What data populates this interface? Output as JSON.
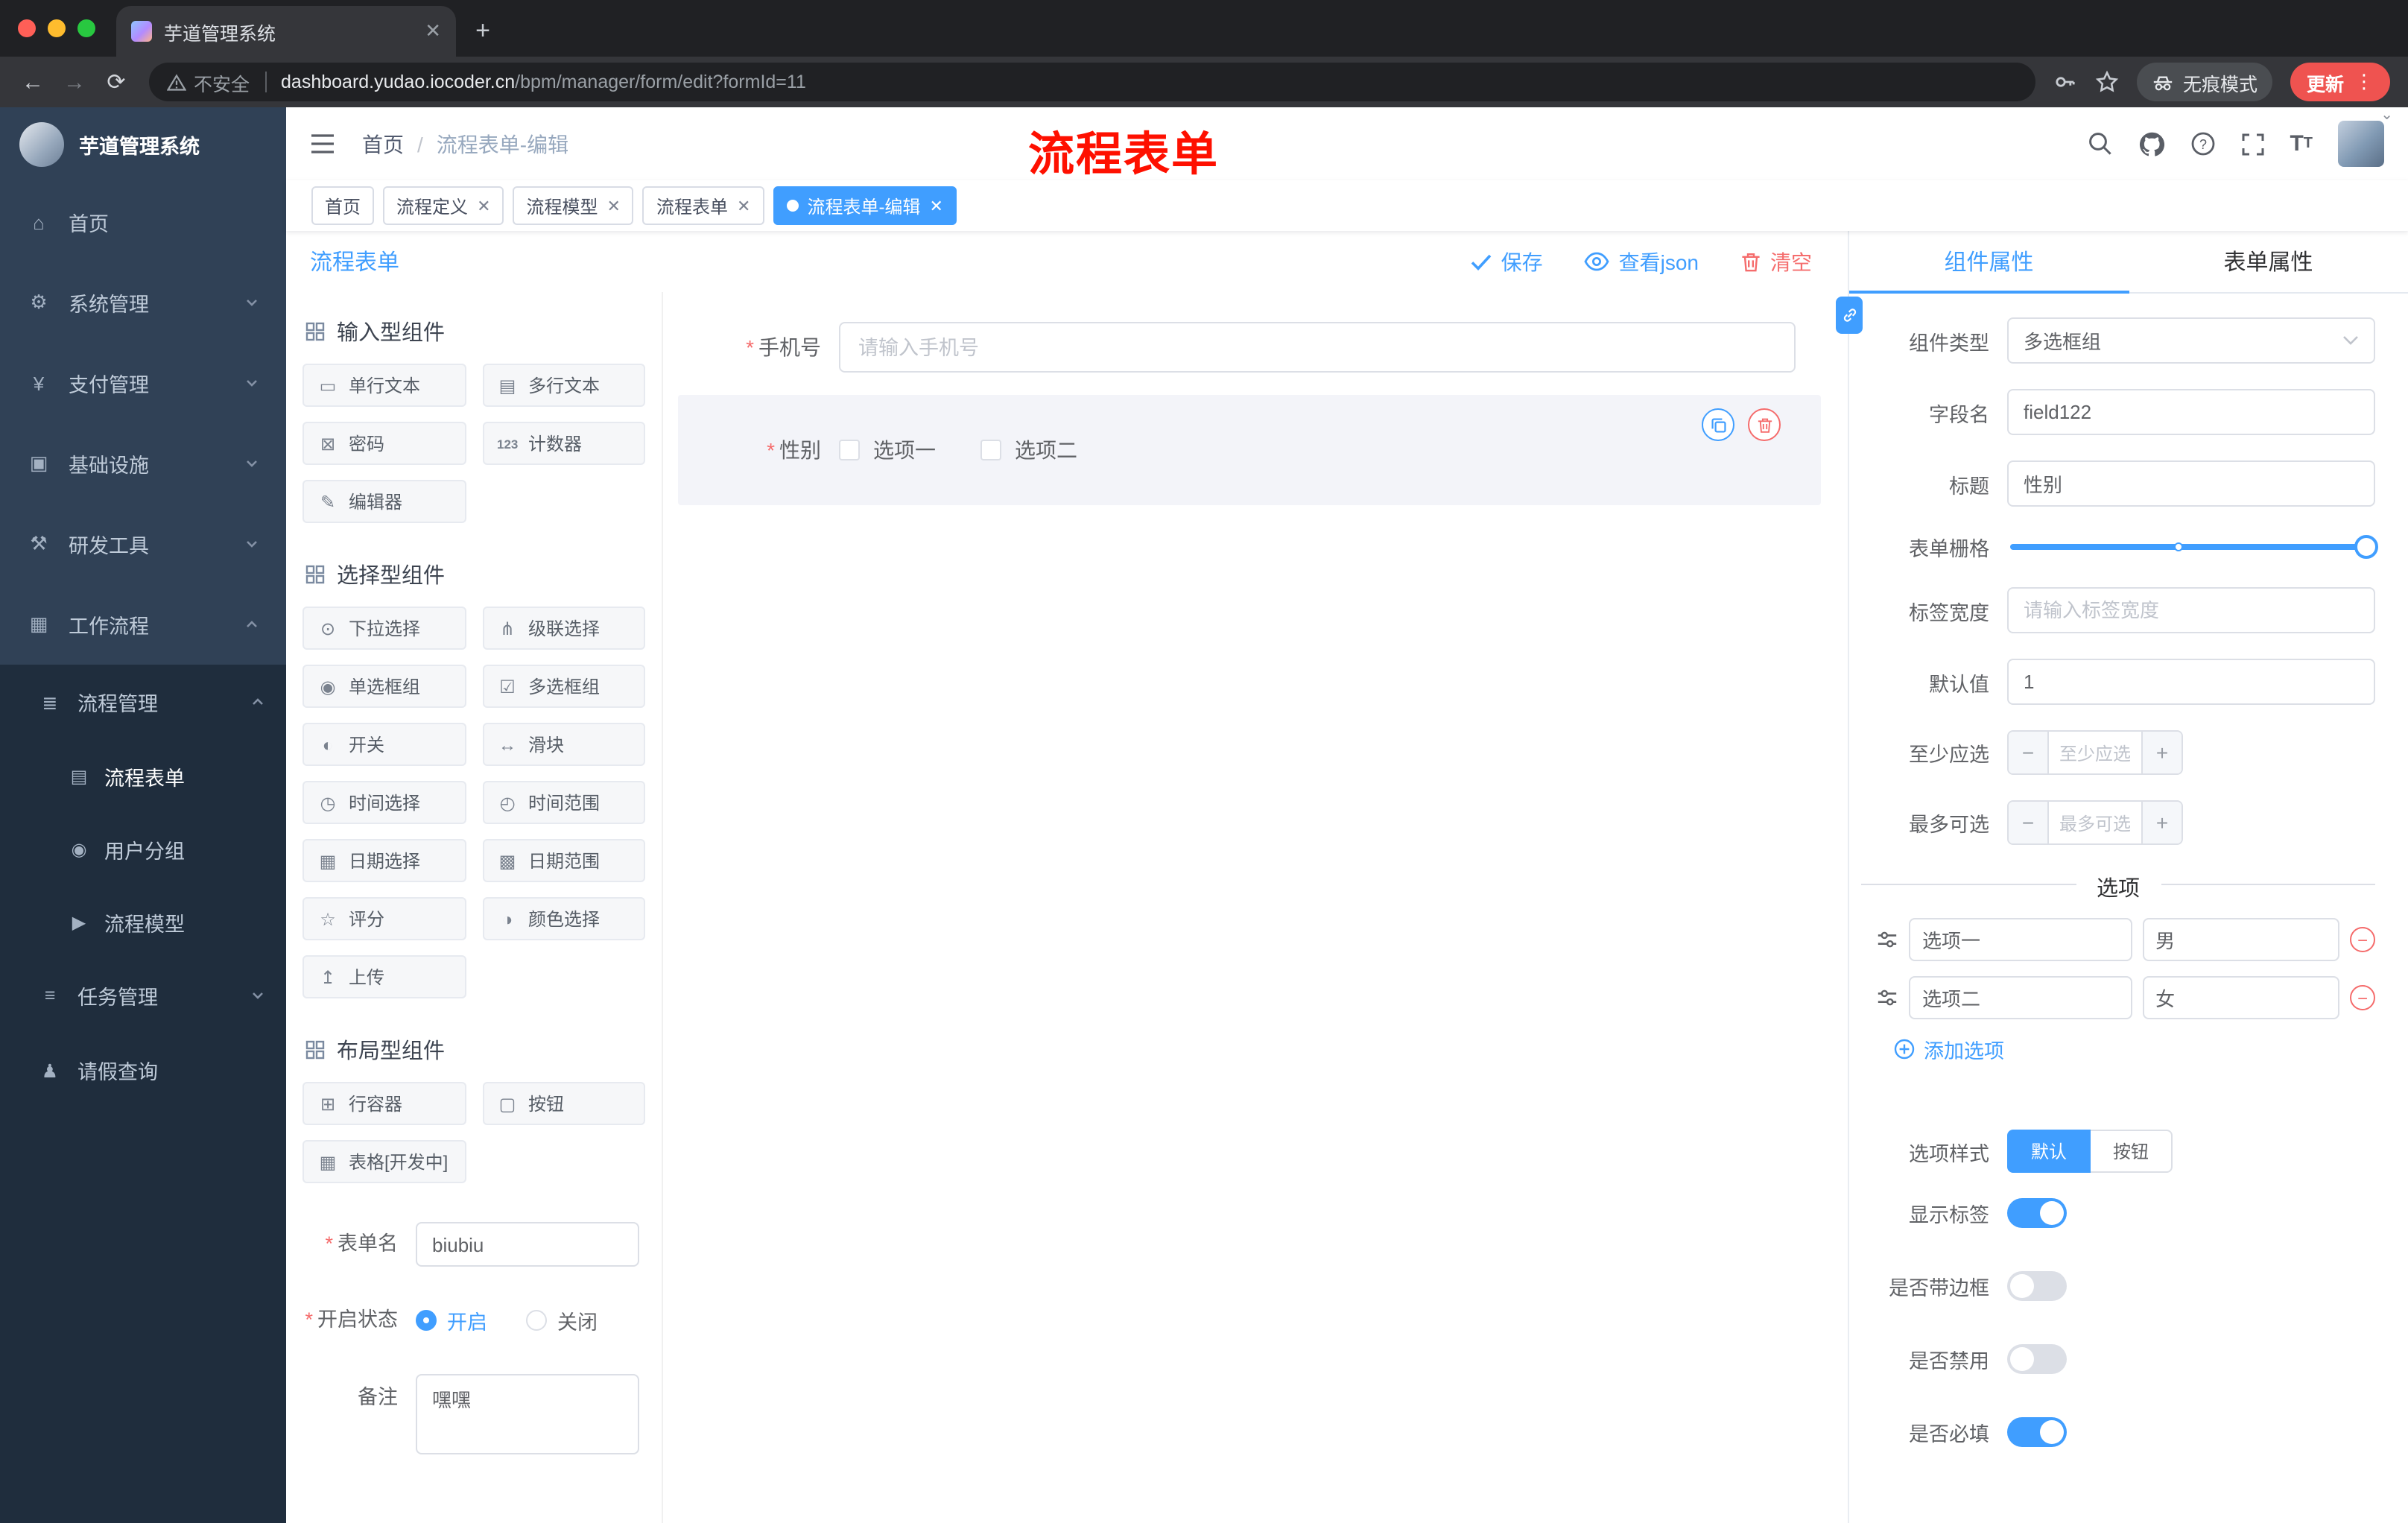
{
  "colors": {
    "accent": "#409eff",
    "danger": "#f56c6c",
    "annotation_red": "#fe1000",
    "sidebar_bg": "#304156",
    "sidebar_sub_bg": "#1f2d3d"
  },
  "browser": {
    "tab_title": "芋道管理系统",
    "security_label": "不安全",
    "url_host": "dashboard.yudao.iocoder.cn",
    "url_path": "/bpm/manager/form/edit?formId=11",
    "incognito_label": "无痕模式",
    "update_label": "更新"
  },
  "sidebar": {
    "logo_title": "芋道管理系统",
    "menu": [
      {
        "icon": "⌂",
        "label": "首页"
      },
      {
        "icon": "⚙",
        "label": "系统管理"
      },
      {
        "icon": "¥",
        "label": "支付管理"
      },
      {
        "icon": "▣",
        "label": "基础设施"
      },
      {
        "icon": "⚒",
        "label": "研发工具"
      },
      {
        "icon": "▦",
        "label": "工作流程"
      }
    ],
    "submenu": {
      "parent": {
        "icon": "≣",
        "label": "流程管理"
      },
      "children": [
        {
          "icon": "▤",
          "label": "流程表单"
        },
        {
          "icon": "◉",
          "label": "用户分组"
        },
        {
          "icon": "▶",
          "label": "流程模型"
        }
      ],
      "siblings": [
        {
          "icon": "≡",
          "label": "任务管理"
        },
        {
          "icon": "♟",
          "label": "请假查询"
        }
      ]
    }
  },
  "header": {
    "breadcrumb_home": "首页",
    "breadcrumb_current": "流程表单-编辑",
    "annotation": "流程表单"
  },
  "tags": [
    {
      "label": "首页"
    },
    {
      "label": "流程定义"
    },
    {
      "label": "流程模型"
    },
    {
      "label": "流程表单"
    },
    {
      "label": "流程表单-编辑"
    }
  ],
  "designer": {
    "panel_title": "流程表单",
    "toolbar": {
      "save": "保存",
      "view_json": "查看json",
      "clear": "清空"
    },
    "groups": [
      {
        "title": "输入型组件",
        "items": [
          {
            "icon": "▭",
            "label": "单行文本"
          },
          {
            "icon": "▤",
            "label": "多行文本"
          },
          {
            "icon": "⊠",
            "label": "密码"
          },
          {
            "icon": "123",
            "label": "计数器"
          },
          {
            "icon": "✎",
            "label": "编辑器"
          }
        ]
      },
      {
        "title": "选择型组件",
        "items": [
          {
            "icon": "⊙",
            "label": "下拉选择"
          },
          {
            "icon": "⋔",
            "label": "级联选择"
          },
          {
            "icon": "◉",
            "label": "单选框组"
          },
          {
            "icon": "☑",
            "label": "多选框组"
          },
          {
            "icon": "◐",
            "label": "开关"
          },
          {
            "icon": "↔",
            "label": "滑块"
          },
          {
            "icon": "◷",
            "label": "时间选择"
          },
          {
            "icon": "◴",
            "label": "时间范围"
          },
          {
            "icon": "▦",
            "label": "日期选择"
          },
          {
            "icon": "▩",
            "label": "日期范围"
          },
          {
            "icon": "☆",
            "label": "评分"
          },
          {
            "icon": "◑",
            "label": "颜色选择"
          },
          {
            "icon": "↥",
            "label": "上传"
          }
        ]
      },
      {
        "title": "布局型组件",
        "items": [
          {
            "icon": "⊞",
            "label": "行容器"
          },
          {
            "icon": "▢",
            "label": "按钮"
          },
          {
            "icon": "▦",
            "label": "表格[开发中]"
          }
        ]
      }
    ],
    "meta": {
      "name_label": "表单名",
      "name_value": "biubiu",
      "status_label": "开启状态",
      "status_on": "开启",
      "status_off": "关闭",
      "remark_label": "备注",
      "remark_value": "嘿嘿"
    },
    "canvas": {
      "phone_label": "手机号",
      "phone_placeholder": "请输入手机号",
      "gender_label": "性别",
      "gender_opt1": "选项一",
      "gender_opt2": "选项二"
    }
  },
  "props": {
    "tab_component": "组件属性",
    "tab_form": "表单属性",
    "type_label": "组件类型",
    "type_value": "多选框组",
    "field_label": "字段名",
    "field_value": "field122",
    "title_label": "标题",
    "title_value": "性别",
    "grid_label": "表单栅格",
    "width_label": "标签宽度",
    "width_placeholder": "请输入标签宽度",
    "default_label": "默认值",
    "default_value": "1",
    "min_label": "至少应选",
    "min_placeholder": "至少应选",
    "max_label": "最多可选",
    "max_placeholder": "最多可选",
    "options_divider": "选项",
    "options": [
      {
        "label": "选项一",
        "value": "男"
      },
      {
        "label": "选项二",
        "value": "女"
      }
    ],
    "add_option": "添加选项",
    "style_label": "选项样式",
    "style_default": "默认",
    "style_button": "按钮",
    "toggles": [
      {
        "label": "显示标签",
        "on": true
      },
      {
        "label": "是否带边框",
        "on": false
      },
      {
        "label": "是否禁用",
        "on": false
      },
      {
        "label": "是否必填",
        "on": true
      }
    ]
  }
}
